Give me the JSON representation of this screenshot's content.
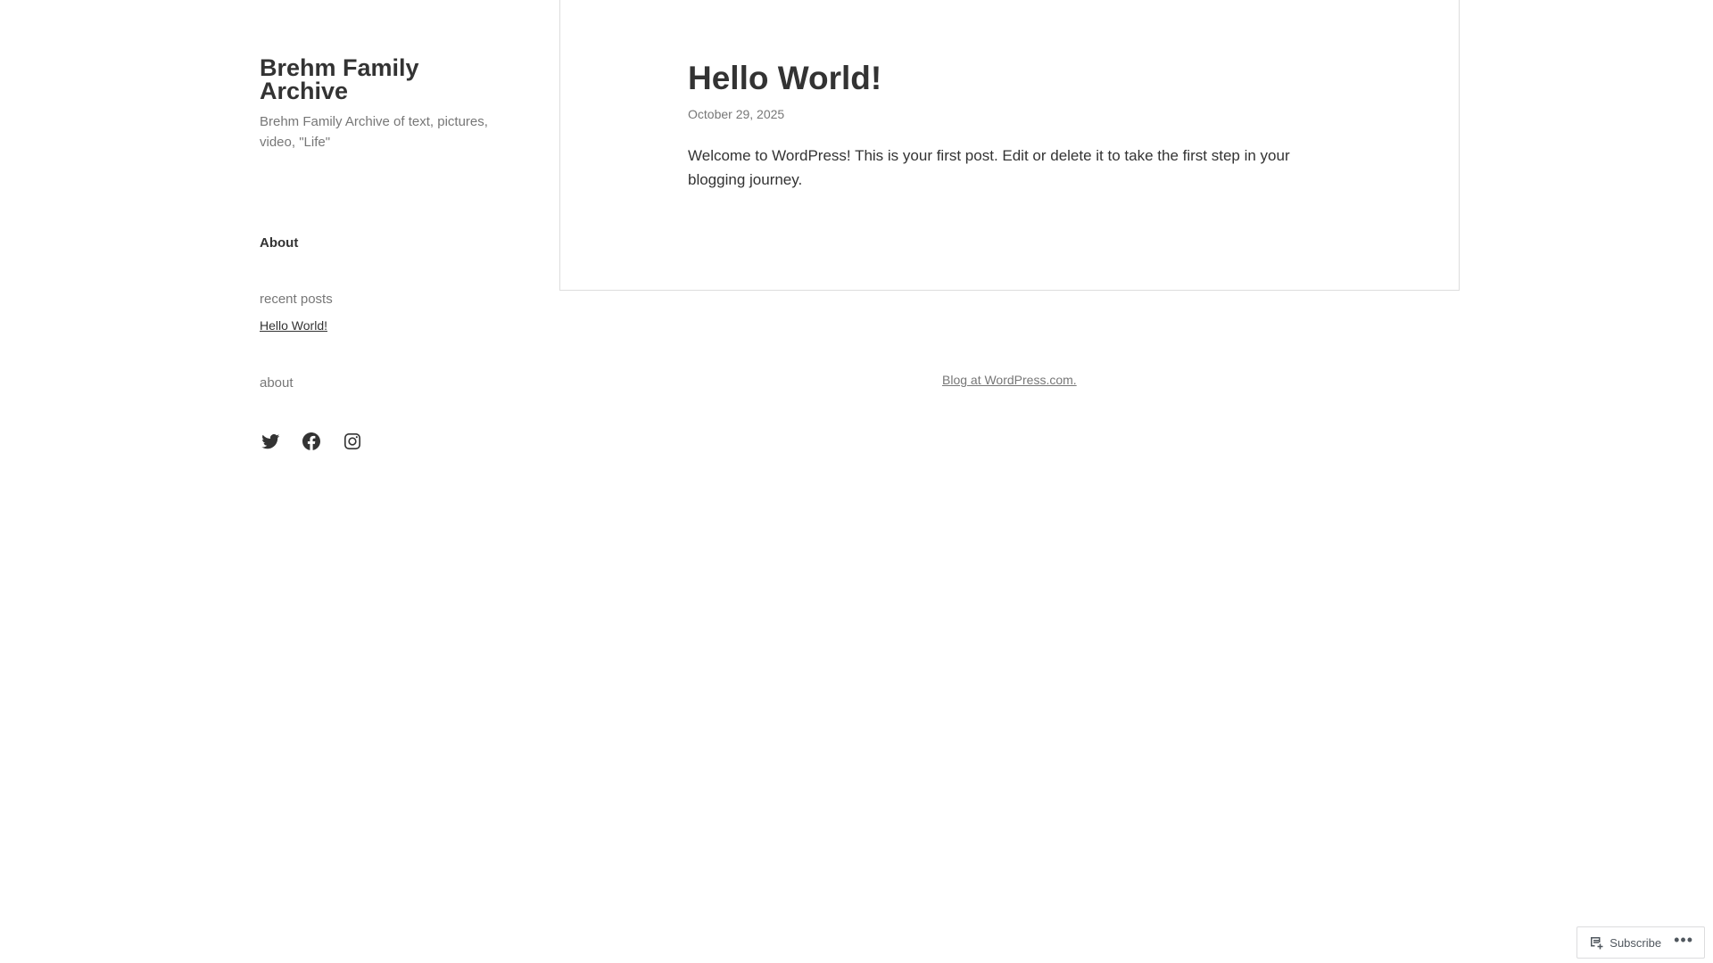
{
  "site": {
    "title": "Brehm Family Archive",
    "description": "Brehm Family Archive of text, pictures, video, \"Life\""
  },
  "nav": {
    "about_label": "About"
  },
  "sidebar": {
    "recent_posts": {
      "title": "recent posts",
      "items": [
        {
          "label": "Hello World!"
        }
      ]
    },
    "about_widget": {
      "title": "about"
    },
    "social": [
      {
        "name": "twitter-icon"
      },
      {
        "name": "facebook-icon"
      },
      {
        "name": "instagram-icon"
      }
    ]
  },
  "post": {
    "title": "Hello World!",
    "date": "October 29, 2025",
    "content": "Welcome to WordPress! This is your first post. Edit or delete it to take the first step in your blogging journey."
  },
  "footer": {
    "credit": "Blog at WordPress.com."
  },
  "subscribe_bar": {
    "subscribe_label": "Subscribe",
    "more_label": "•••"
  }
}
